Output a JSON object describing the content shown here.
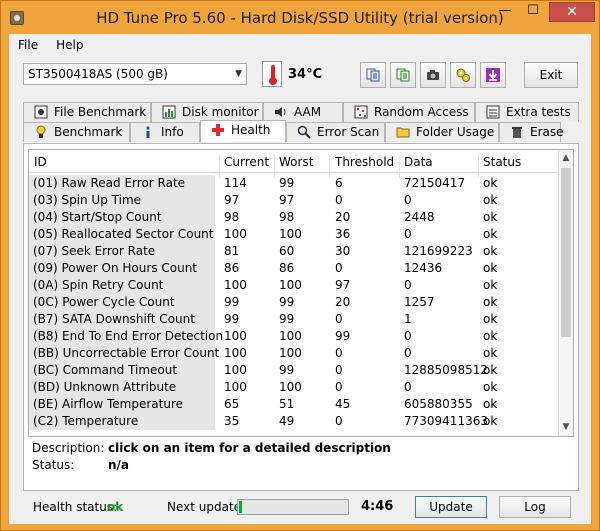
{
  "window": {
    "title": "HD Tune Pro 5.60 - Hard Disk/SSD Utility (trial version)",
    "minimize_glyph": "—",
    "maximize_glyph": "☐",
    "close_glyph": "✕"
  },
  "menu": [
    "File",
    "Help"
  ],
  "toolbar": {
    "drive": "ST3500418AS (500 gB)",
    "temperature": "34°C",
    "exit_label": "Exit",
    "icons": [
      "copy-info-icon",
      "copy-text-icon",
      "screenshot-camera-icon",
      "options-icon",
      "save-download-icon"
    ]
  },
  "tabs": {
    "row1": [
      "File Benchmark",
      "Disk monitor",
      "AAM",
      "Random Access",
      "Extra tests"
    ],
    "row2": [
      "Benchmark",
      "Info",
      "Health",
      "Error Scan",
      "Folder Usage",
      "Erase"
    ],
    "active": "Health"
  },
  "health_table": {
    "columns": [
      "ID",
      "Current",
      "Worst",
      "Threshold",
      "Data",
      "Status"
    ],
    "rows": [
      [
        "(01) Raw Read Error Rate",
        "114",
        "99",
        "6",
        "72150417",
        "ok"
      ],
      [
        "(03) Spin Up Time",
        "97",
        "97",
        "0",
        "0",
        "ok"
      ],
      [
        "(04) Start/Stop Count",
        "98",
        "98",
        "20",
        "2448",
        "ok"
      ],
      [
        "(05) Reallocated Sector Count",
        "100",
        "100",
        "36",
        "0",
        "ok"
      ],
      [
        "(07) Seek Error Rate",
        "81",
        "60",
        "30",
        "121699223",
        "ok"
      ],
      [
        "(09) Power On Hours Count",
        "86",
        "86",
        "0",
        "12436",
        "ok"
      ],
      [
        "(0A) Spin Retry Count",
        "100",
        "100",
        "97",
        "0",
        "ok"
      ],
      [
        "(0C) Power Cycle Count",
        "99",
        "99",
        "20",
        "1257",
        "ok"
      ],
      [
        "(B7) SATA Downshift Count",
        "99",
        "99",
        "0",
        "1",
        "ok"
      ],
      [
        "(B8) End To End Error Detection",
        "100",
        "100",
        "99",
        "0",
        "ok"
      ],
      [
        "(BB) Uncorrectable Error Count",
        "100",
        "100",
        "0",
        "0",
        "ok"
      ],
      [
        "(BC) Command Timeout",
        "100",
        "99",
        "0",
        "12885098512",
        "ok"
      ],
      [
        "(BD) Unknown Attribute",
        "100",
        "100",
        "0",
        "0",
        "ok"
      ],
      [
        "(BE) Airflow Temperature",
        "65",
        "51",
        "45",
        "605880355",
        "ok"
      ],
      [
        "(C2) Temperature",
        "35",
        "49",
        "0",
        "77309411363",
        "ok"
      ]
    ]
  },
  "details": {
    "description_label": "Description:",
    "description_value": "click on an item for a detailed description",
    "status_label": "Status:",
    "status_value": "n/a"
  },
  "footer": {
    "health_label": "Health status:",
    "health_value": "ok",
    "next_update_label": "Next update:",
    "next_update_progress": 0.03,
    "countdown": "4:46",
    "update_label": "Update",
    "log_label": "Log"
  },
  "colors": {
    "title_bar": "#f0a53c",
    "close_button": "#c7504a",
    "health_ok": "#1a9a1a",
    "progress_fill": "#06b025"
  }
}
